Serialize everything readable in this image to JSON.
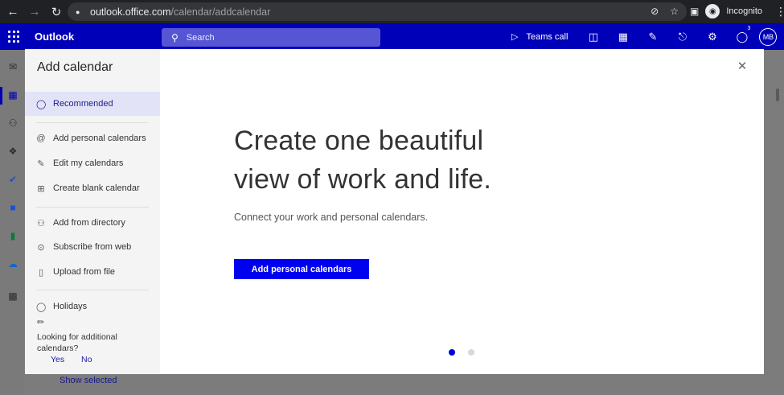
{
  "browser": {
    "url_host": "outlook.office.com",
    "url_path": "/calendar/addcalendar",
    "profile_label": "Incognito"
  },
  "header": {
    "brand": "Outlook",
    "search_placeholder": "Search",
    "teams_call": "Teams call",
    "notification_count": "3",
    "avatar_initials": "MB",
    "accent": "#0000b8"
  },
  "modal": {
    "title": "Add calendar",
    "nav": {
      "recommended": "Recommended",
      "add_personal": "Add personal calendars",
      "edit_my": "Edit my calendars",
      "create_blank": "Create blank calendar",
      "add_directory": "Add from directory",
      "subscribe_web": "Subscribe from web",
      "upload_file": "Upload from file",
      "holidays": "Holidays"
    },
    "feedback": {
      "question": "Looking for additional calendars?",
      "yes": "Yes",
      "no": "No"
    },
    "hero_line1": "Create one beautiful",
    "hero_line2": "view of work and life.",
    "subtitle": "Connect your work and personal calendars.",
    "cta": "Add personal calendars"
  },
  "background": {
    "show_selected": "Show selected"
  }
}
